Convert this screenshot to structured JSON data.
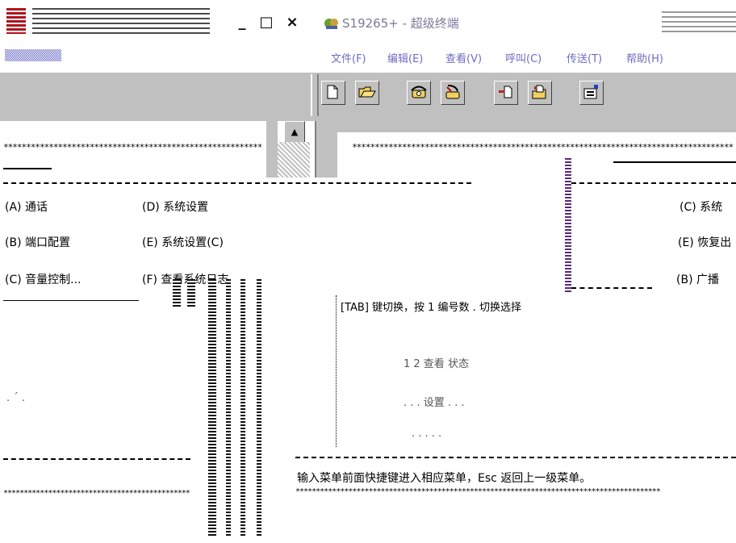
{
  "titlebar": {
    "right_title": "S19265+ - 超级终端"
  },
  "window_buttons": {
    "minimize": "_",
    "maximize": "□",
    "close": "×"
  },
  "menu": {
    "items": [
      "文件(F)",
      "编辑(E)",
      "查看(V)",
      "呼叫(C)",
      "传送(T)",
      "帮助(H)"
    ]
  },
  "toolbar": {
    "buttons": [
      {
        "icon": "new-file-icon"
      },
      {
        "icon": "open-folder-icon"
      },
      {
        "icon": "phone-call-icon"
      },
      {
        "icon": "phone-disconnect-icon"
      },
      {
        "icon": "send-file-icon"
      },
      {
        "icon": "receive-file-icon"
      },
      {
        "icon": "properties-icon"
      }
    ]
  },
  "left_panel": {
    "menu_row1": [
      "(A) 通话",
      "(D) 系统设置"
    ],
    "menu_row2": [
      "(B) 端口配置",
      "(E) 系统设置(C)"
    ],
    "menu_row3": [
      "(C) 音量控制...",
      "(F) 查看系统日志"
    ]
  },
  "right_panel": {
    "side_items": [
      "(C) 系统",
      "(E) 恢复出",
      "(B) 广播"
    ],
    "heading": "[TAB] 键切换，按 1 编号数 .  切换选择",
    "body_lines": [
      "1 2 查看 状态",
      ". . . 设置 . . .",
      ". . . . ."
    ],
    "status": "输入菜单前面快捷键进入相应菜单，Esc 返回上一级菜单。"
  },
  "colors": {
    "toolbar_bg": "#c0c0c0",
    "title_accent": "#b0141c",
    "menu_text": "#3a3ab0"
  }
}
